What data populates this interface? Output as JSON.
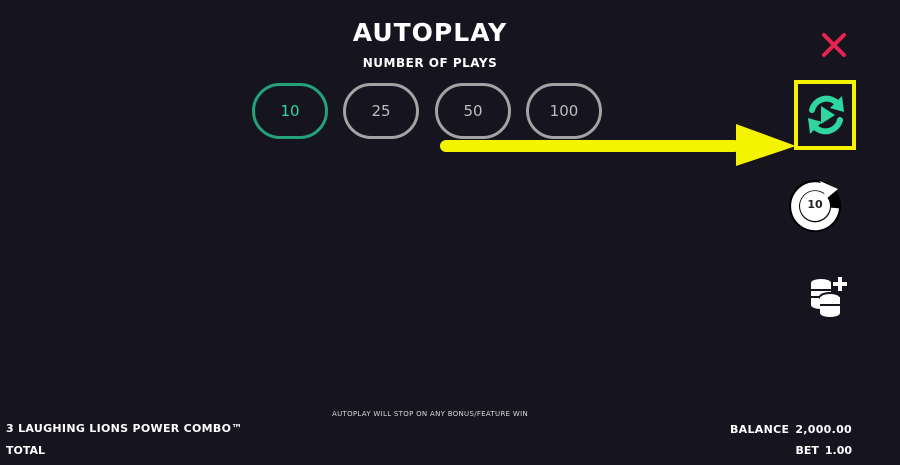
{
  "autoplay": {
    "title": "AUTOPLAY",
    "subtitle": "NUMBER OF PLAYS",
    "options": [
      "10",
      "25",
      "50",
      "100"
    ],
    "selected": "10",
    "notice": "AUTOPLAY WILL STOP ON ANY BONUS/FEATURE WIN"
  },
  "controls": {
    "close_icon": "close-icon",
    "autoplay_icon": "autoplay-refresh-icon",
    "autoplay_count": "10",
    "bet_icon": "coin-stack-plus-icon"
  },
  "footer": {
    "game_name": "3 LAUGHING LIONS POWER COMBO™",
    "total_label": "TOTAL",
    "balance_label": "BALANCE",
    "balance_value": "2,000.00",
    "bet_label": "BET",
    "bet_value": "1.00"
  },
  "colors": {
    "background": "#15141f",
    "accent_green": "#2fd69f",
    "close_red": "#e8234f",
    "highlight_yellow": "#f4f300"
  }
}
